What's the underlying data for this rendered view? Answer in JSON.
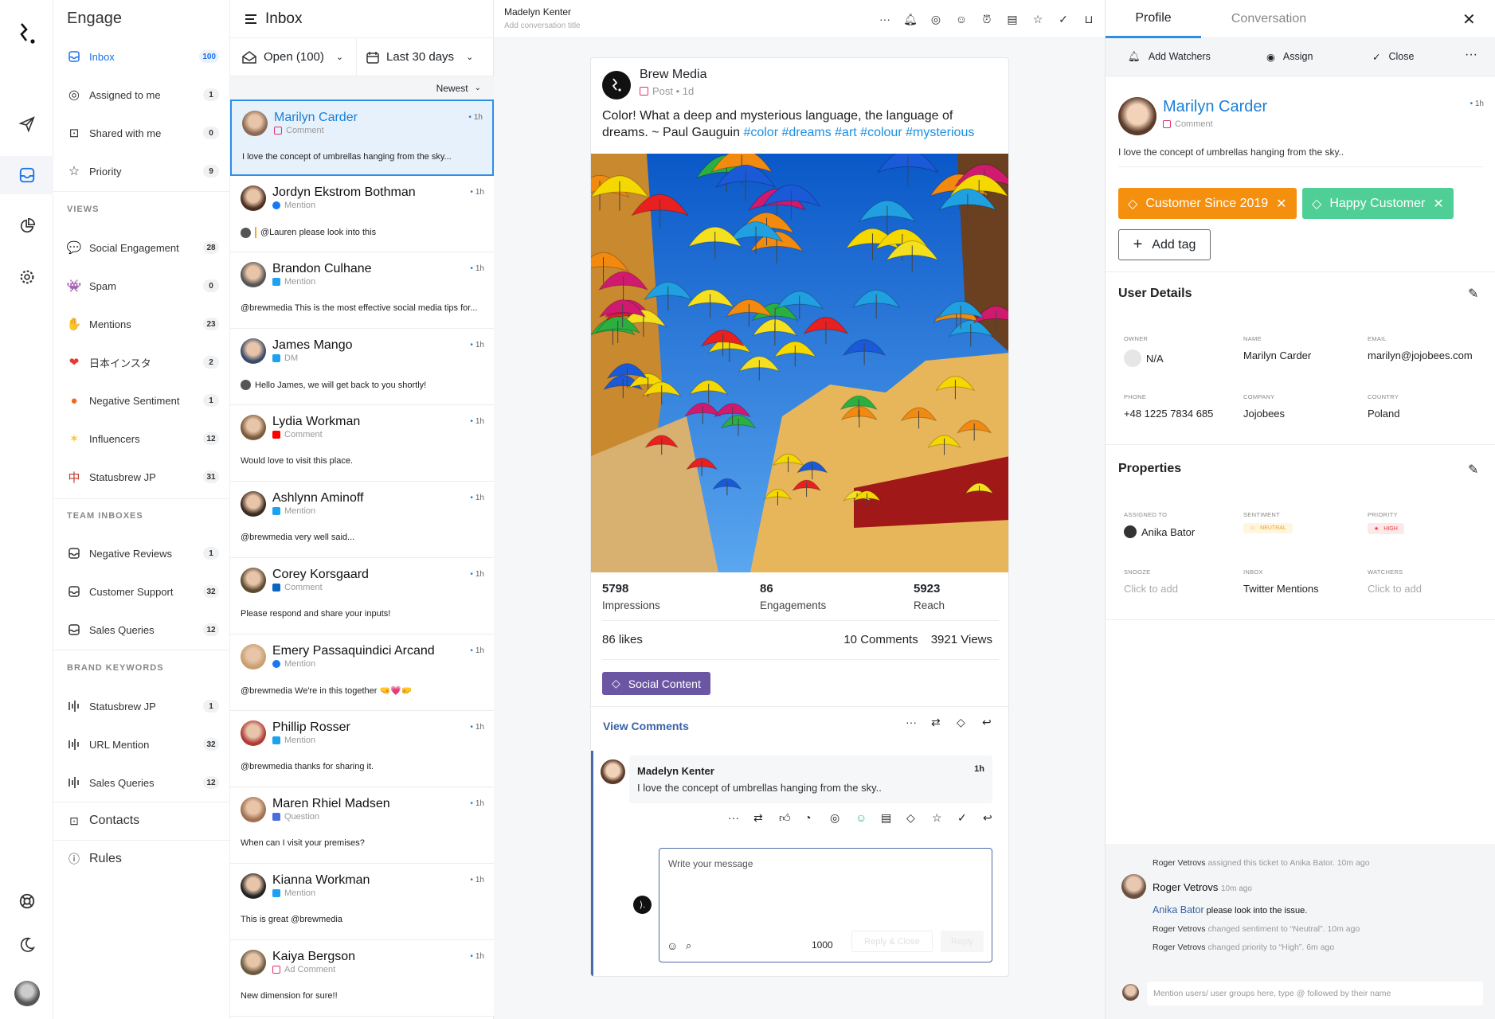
{
  "rail": {
    "items": [
      "logo-icon",
      "send-icon",
      "inbox-icon",
      "reports-icon",
      "settings-icon",
      "help-icon",
      "dark-mode-icon",
      "user-avatar"
    ]
  },
  "sidebar": {
    "title": "Engage",
    "main": [
      {
        "label": "Inbox",
        "count": "100",
        "icon": "inbox-icon",
        "active": true
      },
      {
        "label": "Assigned to me",
        "count": "1",
        "icon": "user-circle-icon"
      },
      {
        "label": "Shared with me",
        "count": "0",
        "icon": "shared-icon"
      },
      {
        "label": "Priority",
        "count": "9",
        "icon": "star-icon"
      }
    ],
    "views_title": "VIEWS",
    "views": [
      {
        "label": "Social Engagement",
        "count": "28",
        "icon": "speech-bubble-icon",
        "glyph": "💬",
        "color": "#bbb"
      },
      {
        "label": "Spam",
        "count": "0",
        "icon": "alien-monster-icon",
        "glyph": "👾",
        "color": "#6b4fa8"
      },
      {
        "label": "Mentions",
        "count": "23",
        "icon": "raised-hand-icon",
        "glyph": "✋",
        "color": "#f3b52c"
      },
      {
        "label": "日本インスタ",
        "count": "2",
        "icon": "heart-icon",
        "glyph": "❤",
        "color": "#e53935"
      },
      {
        "label": "Negative Sentiment",
        "count": "1",
        "icon": "angry-face-icon",
        "glyph": "●",
        "color": "#f06a1d"
      },
      {
        "label": "Influencers",
        "count": "12",
        "icon": "dizzy-icon",
        "glyph": "✶",
        "color": "#f5c842"
      },
      {
        "label": "Statusbrew JP",
        "count": "31",
        "icon": "mahjong-icon",
        "glyph": "中",
        "color": "#c0392b"
      }
    ],
    "team_title": "TEAM INBOXES",
    "team": [
      {
        "label": "Negative Reviews",
        "count": "1"
      },
      {
        "label": "Customer Support",
        "count": "32"
      },
      {
        "label": "Sales Queries",
        "count": "12"
      }
    ],
    "brand_title": "BRAND KEYWORDS",
    "brand": [
      {
        "label": "Statusbrew JP",
        "count": "1"
      },
      {
        "label": "URL Mention",
        "count": "32"
      },
      {
        "label": "Sales Queries",
        "count": "12"
      }
    ],
    "contacts": "Contacts",
    "rules": "Rules"
  },
  "list": {
    "title": "Inbox",
    "status_filter": "Open (100)",
    "date_filter": "Last 30 days",
    "sort": "Newest",
    "items": [
      {
        "name": "Marilyn Carder",
        "platform": "instagram",
        "type": "Comment",
        "time": "1h",
        "preview": "I love the concept of umbrellas hanging from the sky...",
        "selected": true,
        "avatar": "#8a6a55"
      },
      {
        "name": "Jordyn Ekstrom Bothman",
        "platform": "facebook",
        "type": "Mention",
        "time": "1h",
        "preview": "@Lauren please look into this",
        "reply": true,
        "bar": true,
        "avatar": "#4a2e22"
      },
      {
        "name": "Brandon Culhane",
        "platform": "twitter",
        "type": "Mention",
        "time": "1h",
        "preview": "@brewmedia This is the most effective social media tips for...",
        "avatar": "#555"
      },
      {
        "name": "James Mango",
        "platform": "twitter",
        "type": "DM",
        "time": "1h",
        "preview": "Hello James, we will get back to you shortly!",
        "reply": true,
        "avatar": "#3a4a6a"
      },
      {
        "name": "Lydia Workman",
        "platform": "youtube",
        "type": "Comment",
        "time": "1h",
        "preview": "Would love to visit this place.",
        "avatar": "#7a5a3a"
      },
      {
        "name": "Ashlynn Aminoff",
        "platform": "twitter",
        "type": "Mention",
        "time": "1h",
        "preview": "@brewmedia very well said...",
        "avatar": "#3a2a20"
      },
      {
        "name": "Corey Korsgaard",
        "platform": "linkedin",
        "type": "Comment",
        "time": "1h",
        "preview": "Please respond and share your inputs!",
        "avatar": "#5a4a30"
      },
      {
        "name": "Emery Passaquindici Arcand",
        "platform": "facebook",
        "type": "Mention",
        "time": "1h",
        "preview": "@brewmedia We're in this together 🤜💗🤛",
        "avatar": "#c8a070"
      },
      {
        "name": "Phillip Rosser",
        "platform": "twitter",
        "type": "Mention",
        "time": "1h",
        "preview": "@brewmedia thanks for sharing it.",
        "avatar": "#b03a3a"
      },
      {
        "name": "Maren Rhiel Madsen",
        "platform": "gmb",
        "type": "Question",
        "time": "1h",
        "preview": "When can I visit your premises?",
        "avatar": "#a07050"
      },
      {
        "name": "Kianna Workman",
        "platform": "twitter",
        "type": "Mention",
        "time": "1h",
        "preview": "This is great @brewmedia",
        "avatar": "#222"
      },
      {
        "name": "Kaiya Bergson",
        "platform": "instagram",
        "type": "Ad Comment",
        "time": "1h",
        "preview": "New dimension for sure!!",
        "avatar": "#6a5a40"
      }
    ]
  },
  "platform_colors": {
    "instagram": "#e1306c",
    "facebook": "#1877f2",
    "twitter": "#1da1f2",
    "youtube": "#ff0000",
    "linkedin": "#0a66c2",
    "gmb": "#4a6ee0"
  },
  "conversation": {
    "contact": "Madelyn Kenter",
    "title_placeholder": "Add conversation title",
    "header_icons": [
      "more-icon",
      "bell-icon",
      "user-circle-icon",
      "neutral-face-icon",
      "alarm-icon",
      "clipboard-icon",
      "star-icon",
      "check-icon",
      "inbox-icon"
    ],
    "post": {
      "author": "Brew Media",
      "platform": "instagram",
      "meta": "Post • 1d",
      "text": "Color! What a deep and mysterious language, the language of dreams. ~ Paul Gauguin ",
      "hashtags": "#color #dreams #art #colour #mysterious",
      "stats": [
        {
          "value": "5798",
          "label": "Impressions"
        },
        {
          "value": "86",
          "label": "Engagements"
        },
        {
          "value": "5923",
          "label": "Reach"
        }
      ],
      "likes": "86 likes",
      "comments": "10 Comments",
      "views": "3921 Views",
      "tag": "Social Content",
      "tag_color": "#6b56a3"
    },
    "view_comments": "View Comments",
    "comment": {
      "author": "Madelyn Kenter",
      "time": "1h",
      "text": "I love the concept of umbrellas hanging from the sky.."
    },
    "reply": {
      "placeholder": "Write your message",
      "char_count": "1000",
      "reply_close": "Reply & Close",
      "reply": "Reply"
    }
  },
  "profile": {
    "tabs": [
      "Profile",
      "Conversation"
    ],
    "actions": {
      "watchers": "Add Watchers",
      "assign": "Assign",
      "close": "Close"
    },
    "name": "Marilyn Carder",
    "type": "Comment",
    "time": "1h",
    "text": "I love the concept of umbrellas hanging from the sky..",
    "tags": [
      {
        "label": "Customer Since 2019",
        "color": "#f5900f"
      },
      {
        "label": "Happy Customer",
        "color": "#4fcf95"
      }
    ],
    "add_tag": "Add tag",
    "user_details_title": "User Details",
    "details": [
      {
        "label": "OWNER",
        "value": "N/A"
      },
      {
        "label": "NAME",
        "value": "Marilyn Carder"
      },
      {
        "label": "EMAIL",
        "value": "marilyn@jojobees.com"
      },
      {
        "label": "PHONE",
        "value": "+48 1225 7834 685"
      },
      {
        "label": "COMPANY",
        "value": "Jojobees"
      },
      {
        "label": "COUNTRY",
        "value": "Poland"
      }
    ],
    "properties_title": "Properties",
    "properties": [
      {
        "label": "ASSIGNED TO",
        "value": "Anika Bator"
      },
      {
        "label": "SENTIMENT",
        "value": "NEUTRAL"
      },
      {
        "label": "PRIORITY",
        "value": "HIGH"
      },
      {
        "label": "SNOOZE",
        "value": "Click to add"
      },
      {
        "label": "INBOX",
        "value": "Twitter Mentions"
      },
      {
        "label": "WATCHERS",
        "value": "Click to add"
      }
    ],
    "activity": {
      "line1_actor": "Roger Vetrovs",
      "line1_text": " assigned this ticket to Anika Bator.  10m ago",
      "note_author": "Roger Vetrovs",
      "note_time": "10m ago",
      "note_mention": "Anika Bator",
      "note_text": " please look into the issue.",
      "line2_actor": "Roger Vetrovs",
      "line2_text": " changed sentiment to “Neutral”. 10m ago",
      "line3_actor": "Roger Vetrovs",
      "line3_text": " changed priority to “High”. 6m ago"
    },
    "note_placeholder": "Mention users/ user groups here, type @ followed by their name"
  }
}
